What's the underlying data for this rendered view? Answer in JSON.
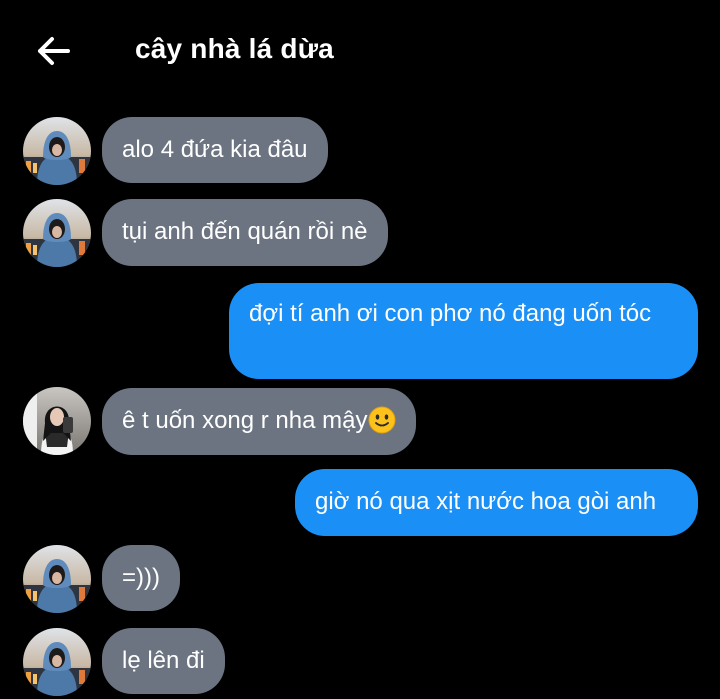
{
  "header": {
    "title": "cây nhà lá dừa",
    "back_icon": "arrow-left-icon"
  },
  "colors": {
    "background": "#000000",
    "incoming_bubble": "#6b7480",
    "outgoing_bubble": "#1a8ff5"
  },
  "messages": [
    {
      "direction": "incoming",
      "text": "alo 4 đứa kia đâu",
      "avatar": "avatar-blue-hoodie"
    },
    {
      "direction": "incoming",
      "text": "tụi anh đến quán rồi nè",
      "avatar": "avatar-blue-hoodie"
    },
    {
      "direction": "outgoing",
      "text": "đợi tí anh ơi con phơ nó đang uốn tóc"
    },
    {
      "direction": "incoming",
      "text": "ê t uốn xong r nha mậy",
      "emoji": "slightly-smiling-face-icon",
      "avatar": "avatar-girl-mirror-selfie"
    },
    {
      "direction": "outgoing",
      "text": "giờ nó qua xịt nước hoa gòi anh"
    },
    {
      "direction": "incoming",
      "text": "=)))",
      "avatar": "avatar-blue-hoodie"
    },
    {
      "direction": "incoming",
      "text": "lẹ lên đi",
      "avatar": "avatar-blue-hoodie"
    }
  ]
}
